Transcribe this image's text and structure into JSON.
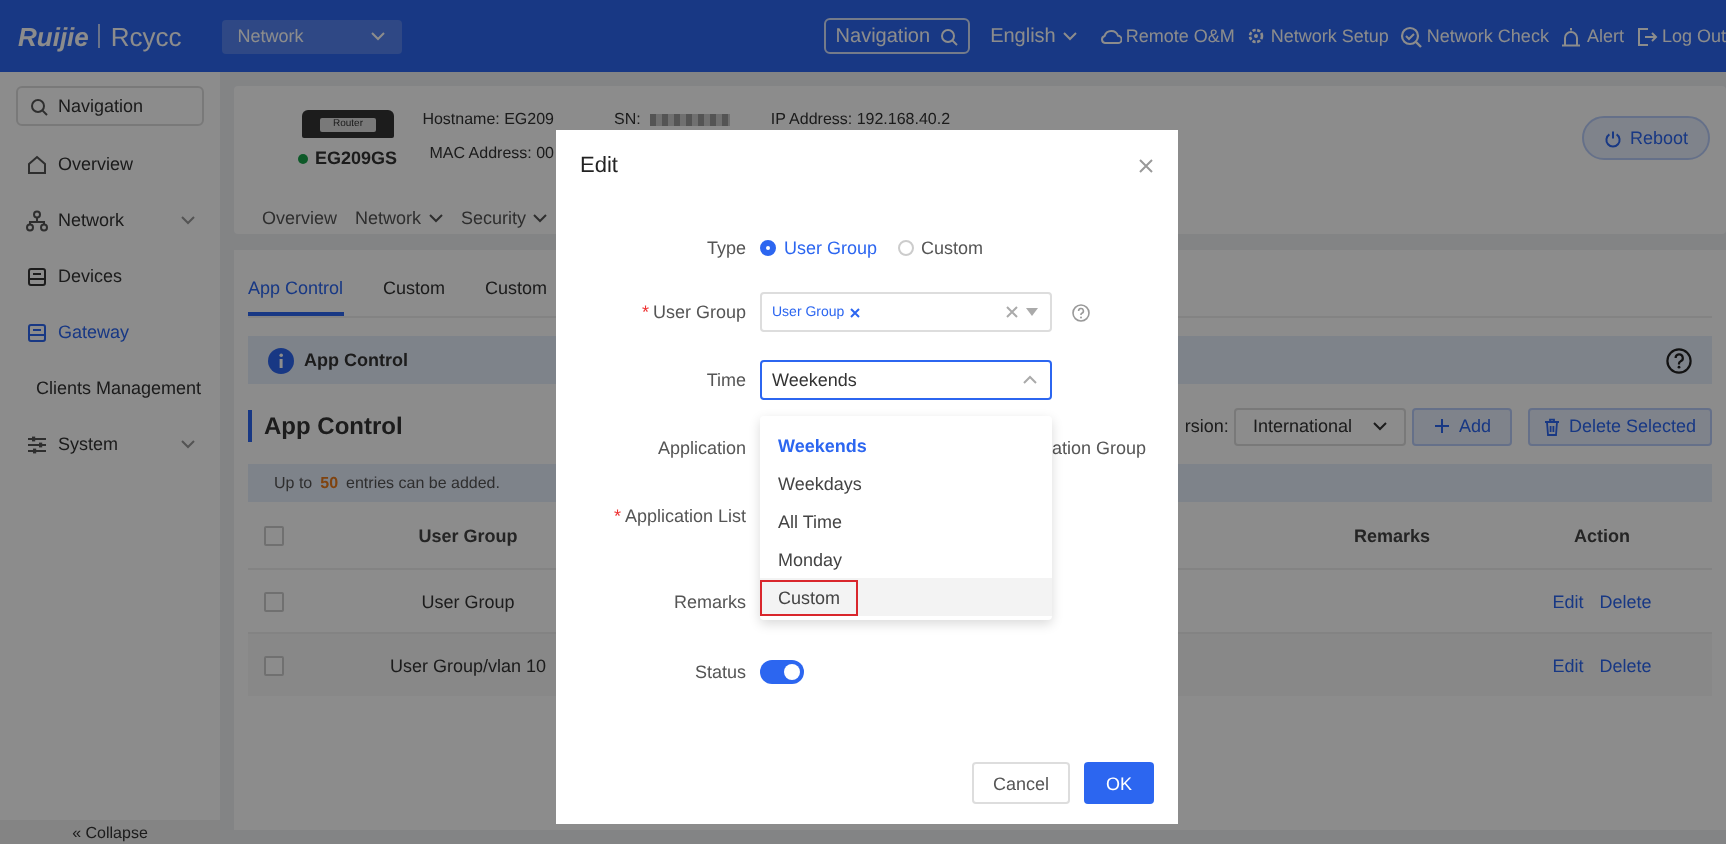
{
  "header": {
    "logo": {
      "brand": "Ruijie",
      "product": "Rcycc"
    },
    "network_select": "Network",
    "nav_search": "Navigation",
    "language": "English",
    "links": [
      {
        "label": "Remote O&M",
        "kind": "cloud"
      },
      {
        "label": "Network Setup",
        "kind": "setup"
      },
      {
        "label": "Network Check",
        "kind": "check"
      },
      {
        "label": "Alert",
        "kind": "alert"
      },
      {
        "label": "Log Out",
        "kind": "logout"
      }
    ]
  },
  "sidebar": {
    "search": "Navigation",
    "items": [
      {
        "label": "Overview",
        "kind": "home",
        "selected": false,
        "expandable": false
      },
      {
        "label": "Network",
        "kind": "network",
        "selected": false,
        "expandable": true
      },
      {
        "label": "Devices",
        "kind": "device",
        "selected": false,
        "expandable": false
      },
      {
        "label": "Gateway",
        "kind": "device",
        "selected": true,
        "expandable": false
      },
      {
        "label": "Clients Management",
        "kind": "client",
        "selected": false,
        "expandable": false
      },
      {
        "label": "System",
        "kind": "system",
        "selected": false,
        "expandable": true
      }
    ],
    "collapse": "« Collapse"
  },
  "device": {
    "icon_label": "Router",
    "model": "EG209GS",
    "online": true,
    "hostname": "Hostname: EG209",
    "mac": "MAC Address: 00",
    "sn": "SN:",
    "ip": "IP Address: 192.168.40.2",
    "reboot": "Reboot",
    "nav": [
      {
        "label": "Overview",
        "dropdown": false
      },
      {
        "label": "Network",
        "dropdown": true
      },
      {
        "label": "Security",
        "dropdown": true
      }
    ]
  },
  "content": {
    "tabs": [
      {
        "label": "App Control",
        "selected": true
      },
      {
        "label": "Custom",
        "selected": false
      },
      {
        "label": "Custom",
        "selected": false
      }
    ],
    "info_title": "App Control",
    "section_title": "App Control",
    "version_label": "rsion:",
    "version_value": "International",
    "add": "Add",
    "delete_selected": "Delete Selected",
    "note": {
      "before": "Up to",
      "count": "50",
      "after": "entries can be added."
    },
    "table": {
      "all_checked": false,
      "columns": [
        "User Group",
        "Remarks",
        "Action"
      ],
      "rows": [
        {
          "checked": false,
          "user_group": "User Group",
          "actions": [
            "Edit",
            "Delete"
          ]
        },
        {
          "checked": false,
          "user_group": "User Group/vlan 10",
          "actions": [
            "Edit",
            "Delete"
          ]
        }
      ]
    }
  },
  "dialog": {
    "title": "Edit",
    "type": {
      "label": "Type",
      "options": [
        {
          "label": "User Group",
          "selected": true
        },
        {
          "label": "Custom",
          "selected": false
        }
      ]
    },
    "user_group": {
      "label": "User Group",
      "required_mark": "*",
      "tags": [
        "User Group"
      ]
    },
    "time": {
      "label": "Time",
      "value": "Weekends",
      "expanded": true,
      "options": [
        {
          "label": "Weekends",
          "selected": true,
          "highlighted": false
        },
        {
          "label": "Weekdays",
          "selected": false,
          "highlighted": false
        },
        {
          "label": "All Time",
          "selected": false,
          "highlighted": false
        },
        {
          "label": "Monday",
          "selected": false,
          "highlighted": false
        },
        {
          "label": "Custom",
          "selected": false,
          "highlighted": true
        }
      ]
    },
    "application": {
      "label": "Application",
      "visible_option": "ation Group"
    },
    "application_list": {
      "label": "Application List",
      "required_mark": "*"
    },
    "remarks": {
      "label": "Remarks"
    },
    "status": {
      "label": "Status",
      "on": true
    },
    "buttons": {
      "cancel": "Cancel",
      "ok": "OK"
    }
  }
}
